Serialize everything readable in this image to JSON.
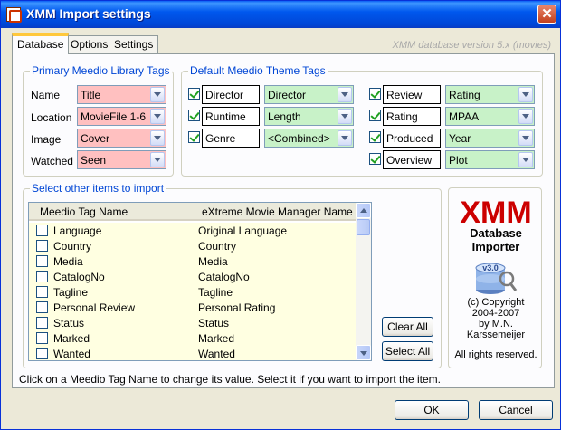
{
  "window": {
    "title": "XMM Import settings"
  },
  "tabs": [
    {
      "label": "Database",
      "active": true
    },
    {
      "label": "Options",
      "active": false
    },
    {
      "label": "Settings",
      "active": false
    }
  ],
  "version_text": "XMM database version 5.x (movies)",
  "primary": {
    "legend": "Primary Meedio Library Tags",
    "rows": [
      {
        "label": "Name",
        "value": "Title"
      },
      {
        "label": "Location",
        "value": "MovieFile 1-6"
      },
      {
        "label": "Image",
        "value": "Cover"
      },
      {
        "label": "Watched",
        "value": "Seen"
      }
    ]
  },
  "theme": {
    "legend": "Default Meedio Theme Tags",
    "left": [
      {
        "checked": true,
        "tag": "Director",
        "value": "Director"
      },
      {
        "checked": true,
        "tag": "Runtime",
        "value": "Length"
      },
      {
        "checked": true,
        "tag": "Genre",
        "value": "<Combined>"
      }
    ],
    "right": [
      {
        "checked": true,
        "tag": "Review",
        "value": "Rating"
      },
      {
        "checked": true,
        "tag": "Rating",
        "value": "MPAA"
      },
      {
        "checked": true,
        "tag": "Produced",
        "value": "Year"
      },
      {
        "checked": true,
        "tag": "Overview",
        "value": "Plot"
      }
    ]
  },
  "other": {
    "legend": "Select other items to import",
    "columns": [
      "Meedio Tag Name",
      "eXtreme Movie Manager Name"
    ],
    "rows": [
      {
        "tag": "Language",
        "xmm": "Original Language"
      },
      {
        "tag": "Country",
        "xmm": "Country"
      },
      {
        "tag": "Media",
        "xmm": "Media"
      },
      {
        "tag": "CatalogNo",
        "xmm": "CatalogNo"
      },
      {
        "tag": "Tagline",
        "xmm": "Tagline"
      },
      {
        "tag": "Personal Review",
        "xmm": "Personal Rating"
      },
      {
        "tag": "Status",
        "xmm": "Status"
      },
      {
        "tag": "Marked",
        "xmm": "Marked"
      },
      {
        "tag": "Wanted",
        "xmm": "Wanted"
      }
    ],
    "clear_all": "Clear All",
    "select_all": "Select All"
  },
  "logo": {
    "title": "XMM",
    "subtitle_1": "Database",
    "subtitle_2": "Importer",
    "copyright_1": "(c) Copyright",
    "copyright_2": "2004-2007",
    "copyright_3": "by M.N.",
    "copyright_4": "Karssemeijer",
    "rights": "All rights reserved.",
    "badge": "v3.0"
  },
  "hint": "Click on a Meedio Tag Name to change its value. Select it if you want to import the item.",
  "buttons": {
    "ok": "OK",
    "cancel": "Cancel"
  }
}
